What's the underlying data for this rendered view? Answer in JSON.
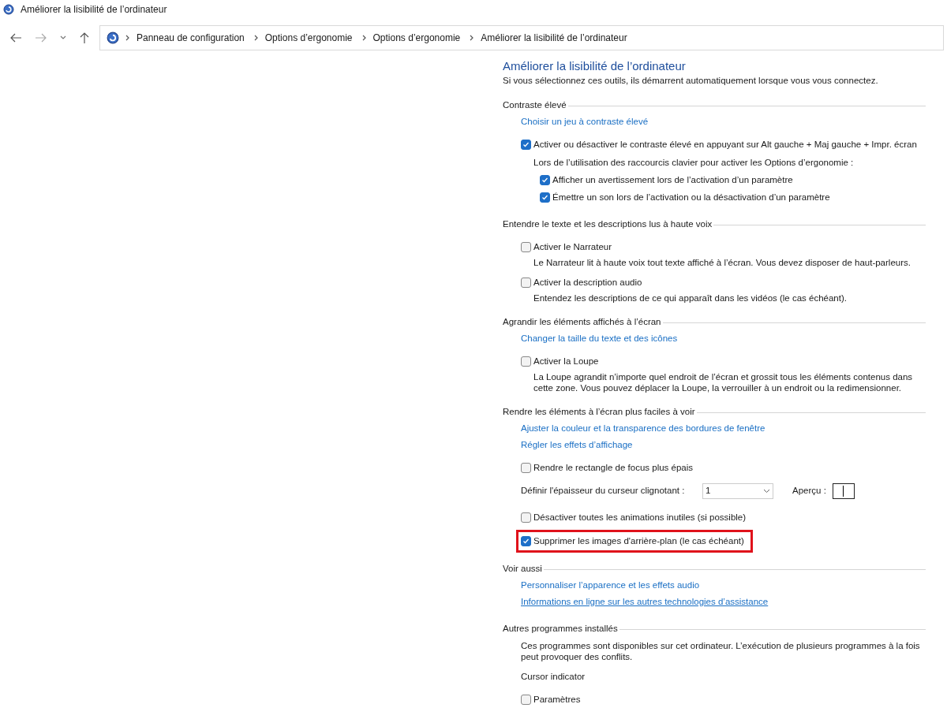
{
  "window": {
    "title": "Améliorer la lisibilité de l’ordinateur"
  },
  "address_bar": {
    "breadcrumbs": [
      "Panneau de configuration",
      "Options d’ergonomie",
      "Options d’ergonomie",
      "Améliorer la lisibilité de l’ordinateur"
    ]
  },
  "page": {
    "title": "Améliorer la lisibilité de l’ordinateur",
    "subtitle": "Si vous sélectionnez ces outils, ils démarrent automatiquement lorsque vous vous connectez."
  },
  "sections": [
    {
      "heading": "Contraste élevé",
      "items": [
        {
          "kind": "link",
          "label": "Choisir un jeu à contraste élevé",
          "hovered": false
        },
        {
          "kind": "checkbox",
          "label": "Activer ou désactiver le contraste élevé en appuyant sur Alt gauche + Maj gauche + Impr. écran",
          "checked": true,
          "highlighted": false
        },
        {
          "kind": "note",
          "label": "Lors de l’utilisation des raccourcis clavier pour activer les Options d’ergonomie :",
          "children": [
            {
              "kind": "checkbox",
              "label": "Afficher un avertissement lors de l’activation d’un paramètre",
              "checked": true,
              "highlighted": false
            },
            {
              "kind": "checkbox",
              "label": "Émettre un son lors de l’activation ou la désactivation d’un paramètre",
              "checked": true,
              "highlighted": false
            }
          ]
        }
      ]
    },
    {
      "heading": "Entendre le texte et les descriptions lus à haute voix",
      "items": [
        {
          "kind": "checkbox",
          "label": "Activer le Narrateur",
          "checked": false,
          "highlighted": false,
          "description": "Le Narrateur lit à haute voix tout texte affiché à l’écran. Vous devez disposer de haut-parleurs."
        },
        {
          "kind": "checkbox",
          "label": "Activer la description audio",
          "checked": false,
          "highlighted": false,
          "description": "Entendez les descriptions de ce qui apparaît dans les vidéos (le cas échéant)."
        }
      ]
    },
    {
      "heading": "Agrandir les éléments affichés à l’écran",
      "items": [
        {
          "kind": "link",
          "label": "Changer la taille du texte et des icônes",
          "hovered": false
        },
        {
          "kind": "checkbox",
          "label": "Activer la Loupe",
          "checked": false,
          "highlighted": false,
          "description": "La Loupe agrandit n’importe quel endroit de l’écran et grossit tous les éléments contenus dans cette zone. Vous pouvez déplacer la Loupe, la verrouiller à un endroit ou la redimensionner."
        }
      ]
    },
    {
      "heading": "Rendre les éléments à l’écran plus faciles à voir",
      "items": [
        {
          "kind": "link",
          "label": "Ajuster la couleur et la transparence des bordures de fenêtre",
          "hovered": false
        },
        {
          "kind": "link",
          "label": "Régler les effets d’affichage",
          "hovered": false
        },
        {
          "kind": "checkbox",
          "label": "Rendre le rectangle de focus plus épais",
          "checked": false,
          "highlighted": false
        },
        {
          "kind": "select",
          "label": "Définir l'épaisseur du curseur clignotant :",
          "value": "1",
          "preview_label": "Aperçu :"
        },
        {
          "kind": "checkbox",
          "label": "Désactiver toutes les animations inutiles (si possible)",
          "checked": false,
          "highlighted": false
        },
        {
          "kind": "checkbox",
          "label": "Supprimer les images d'arrière-plan (le cas échéant)",
          "checked": true,
          "highlighted": true
        }
      ]
    },
    {
      "heading": "Voir aussi",
      "items": [
        {
          "kind": "link",
          "label": "Personnaliser l’apparence et les effets audio",
          "hovered": false
        },
        {
          "kind": "link",
          "label": "Informations en ligne sur les autres technologies d’assistance",
          "hovered": true
        }
      ]
    },
    {
      "heading": "Autres programmes installés",
      "items": [
        {
          "kind": "text",
          "label": "Ces programmes sont disponibles sur cet ordinateur. L’exécution de plusieurs programmes à la fois peut provoquer des conflits."
        },
        {
          "kind": "subheading",
          "label": "Cursor indicator"
        },
        {
          "kind": "checkbox",
          "label": "Paramètres",
          "checked": false,
          "highlighted": false
        }
      ]
    }
  ]
}
